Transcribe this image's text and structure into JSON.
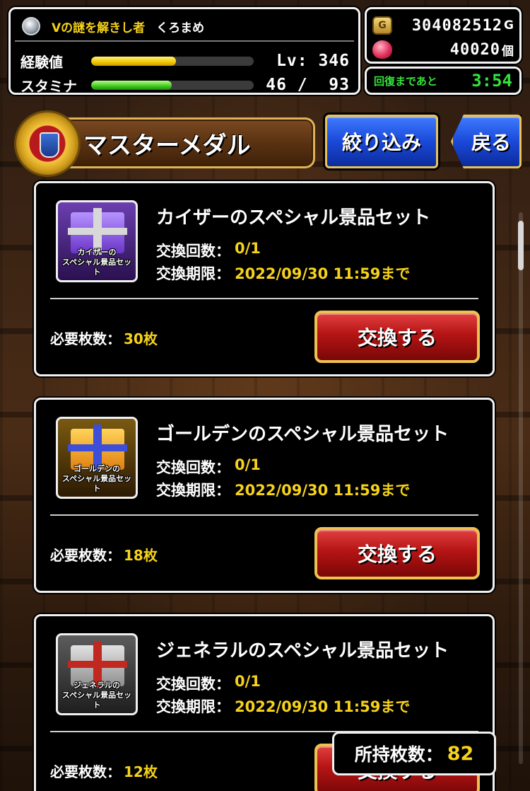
{
  "player": {
    "title": "Vの謎を解きし者",
    "name": "くろまめ",
    "exp": {
      "label": "経験値",
      "level_text": "Lv: 346",
      "fill_fraction": 0.52
    },
    "stamina": {
      "label": "スタミナ",
      "value_text": "46 /  93",
      "current": 46,
      "max": 93
    }
  },
  "currency": {
    "gold_icon_letter": "G",
    "gold": "304082512",
    "gold_unit": "G",
    "gems": "40020",
    "gems_unit": "個"
  },
  "recovery": {
    "label": "回復まであと",
    "time": "3:54"
  },
  "header": {
    "title": "マスターメダル",
    "filter_button": "絞り込み",
    "back_button": "戻る"
  },
  "items": [
    {
      "name": "カイザーのスペシャル景品セット",
      "thumb_caption_1": "カイザーの",
      "thumb_caption_2": "スペシャル景品セット",
      "count_label": "交換回数：",
      "count": "0/1",
      "deadline_label": "交換期限：",
      "deadline": "2022/09/30 11:59まで",
      "required_label": "必要枚数：",
      "required": "30枚",
      "button": "交換する"
    },
    {
      "name": "ゴールデンのスペシャル景品セット",
      "thumb_caption_1": "ゴールデンの",
      "thumb_caption_2": "スペシャル景品セット",
      "count_label": "交換回数：",
      "count": "0/1",
      "deadline_label": "交換期限：",
      "deadline": "2022/09/30 11:59まで",
      "required_label": "必要枚数：",
      "required": "18枚",
      "button": "交換する"
    },
    {
      "name": "ジェネラルのスペシャル景品セット",
      "thumb_caption_1": "ジェネラルの",
      "thumb_caption_2": "スペシャル景品セット",
      "count_label": "交換回数：",
      "count": "0/1",
      "deadline_label": "交換期限：",
      "deadline": "2022/09/30 11:59まで",
      "required_label": "必要枚数：",
      "required": "12枚",
      "button": "交換する"
    }
  ],
  "owned": {
    "label": "所持枚数：",
    "value": "82"
  }
}
